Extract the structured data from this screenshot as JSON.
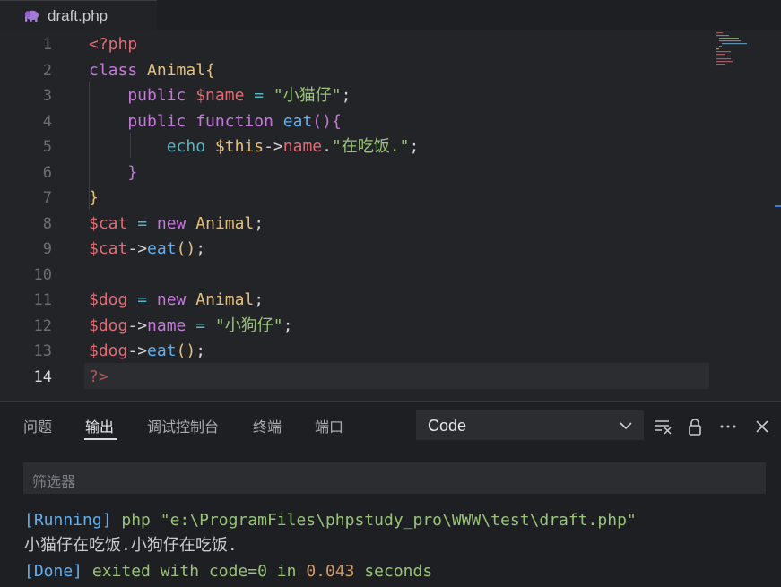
{
  "tab": {
    "filename": "draft.php",
    "icon": "php-elephant-icon"
  },
  "editor": {
    "active_line": 14,
    "lines": [
      {
        "n": "1",
        "tokens": [
          {
            "t": "<?php",
            "c": "tag"
          }
        ]
      },
      {
        "n": "2",
        "tokens": [
          {
            "t": "class ",
            "c": "kw"
          },
          {
            "t": "Animal",
            "c": "cls"
          },
          {
            "t": "{",
            "c": "br1"
          }
        ]
      },
      {
        "n": "3",
        "tokens": [
          {
            "t": "    public ",
            "c": "kw"
          },
          {
            "t": "$name",
            "c": "var"
          },
          {
            "t": " = ",
            "c": "op"
          },
          {
            "t": "\"小猫仔\"",
            "c": "str"
          },
          {
            "t": ";",
            "c": ""
          }
        ]
      },
      {
        "n": "4",
        "tokens": [
          {
            "t": "    public ",
            "c": "kw"
          },
          {
            "t": "function ",
            "c": "kw"
          },
          {
            "t": "eat",
            "c": "fn"
          },
          {
            "t": "(){",
            "c": "br2"
          }
        ]
      },
      {
        "n": "5",
        "tokens": [
          {
            "t": "        echo ",
            "c": "echo"
          },
          {
            "t": "$this",
            "c": "cls"
          },
          {
            "t": "->",
            "c": ""
          },
          {
            "t": "name",
            "c": "var"
          },
          {
            "t": ".",
            "c": ""
          },
          {
            "t": "\"在吃饭.\"",
            "c": "str"
          },
          {
            "t": ";",
            "c": ""
          }
        ]
      },
      {
        "n": "6",
        "tokens": [
          {
            "t": "    }",
            "c": "br2"
          }
        ]
      },
      {
        "n": "7",
        "tokens": [
          {
            "t": "}",
            "c": "br1"
          }
        ]
      },
      {
        "n": "8",
        "tokens": [
          {
            "t": "$cat",
            "c": "var"
          },
          {
            "t": " = ",
            "c": "op"
          },
          {
            "t": "new ",
            "c": "kw"
          },
          {
            "t": "Animal",
            "c": "cls"
          },
          {
            "t": ";",
            "c": ""
          }
        ]
      },
      {
        "n": "9",
        "tokens": [
          {
            "t": "$cat",
            "c": "var"
          },
          {
            "t": "->",
            "c": ""
          },
          {
            "t": "eat",
            "c": "fn"
          },
          {
            "t": "()",
            "c": "br1"
          },
          {
            "t": ";",
            "c": ""
          }
        ]
      },
      {
        "n": "10",
        "tokens": []
      },
      {
        "n": "11",
        "tokens": [
          {
            "t": "$dog",
            "c": "var"
          },
          {
            "t": " = ",
            "c": "op"
          },
          {
            "t": "new ",
            "c": "kw"
          },
          {
            "t": "Animal",
            "c": "cls"
          },
          {
            "t": ";",
            "c": ""
          }
        ]
      },
      {
        "n": "12",
        "tokens": [
          {
            "t": "$dog",
            "c": "var"
          },
          {
            "t": "->",
            "c": ""
          },
          {
            "t": "name",
            "c": "kw"
          },
          {
            "t": " = ",
            "c": "op"
          },
          {
            "t": "\"小狗仔\"",
            "c": "str"
          },
          {
            "t": ";",
            "c": ""
          }
        ]
      },
      {
        "n": "13",
        "tokens": [
          {
            "t": "$dog",
            "c": "var"
          },
          {
            "t": "->",
            "c": ""
          },
          {
            "t": "eat",
            "c": "fn"
          },
          {
            "t": "()",
            "c": "br1"
          },
          {
            "t": ";",
            "c": ""
          }
        ]
      },
      {
        "n": "14",
        "tokens": [
          {
            "t": "?>",
            "c": "tagdim"
          }
        ]
      }
    ]
  },
  "panel": {
    "tabs": [
      "问题",
      "输出",
      "调试控制台",
      "终端",
      "端口"
    ],
    "active_tab": "输出",
    "channel_select": "Code",
    "filter_placeholder": "筛选器",
    "output": {
      "line1_tag": "[Running]",
      "line1_cmd": " php \"e:\\ProgramFiles\\phpstudy_pro\\WWW\\test\\draft.php\"",
      "line2": "小猫仔在吃饭.小狗仔在吃饭.",
      "line3_tag": "[Done]",
      "line3_a": " exited with ",
      "line3_code": "code=0",
      "line3_b": " in ",
      "line3_time": "0.043",
      "line3_c": " seconds"
    }
  },
  "colors": {
    "accent": "#3e7bd6",
    "editor_bg": "#232428",
    "panel_bg": "#1e1f22"
  }
}
